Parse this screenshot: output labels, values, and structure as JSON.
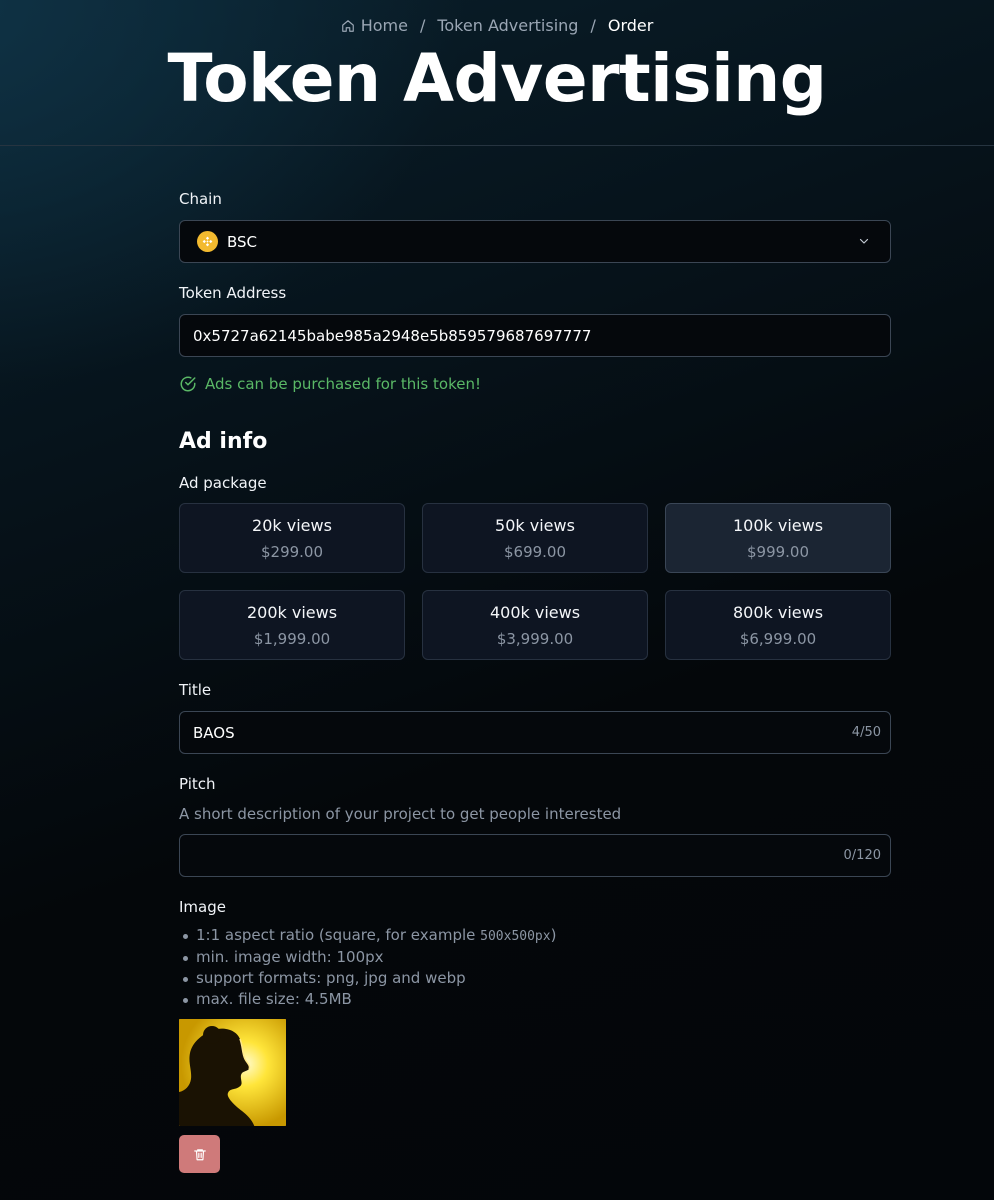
{
  "breadcrumb": {
    "home": "Home",
    "section": "Token Advertising",
    "current": "Order",
    "separator": "/"
  },
  "page": {
    "title": "Token Advertising"
  },
  "chain": {
    "label": "Chain",
    "selected": "BSC",
    "icon": "bnb-coin-icon"
  },
  "token_address": {
    "label": "Token Address",
    "value": "0x5727a62145babe985a2948e5b859579687697777",
    "status_icon": "check-circle-icon",
    "status": "Ads can be purchased for this token!"
  },
  "ad_info": {
    "title": "Ad info",
    "package_label": "Ad package",
    "packages": [
      {
        "views": "20k views",
        "price": "$299.00"
      },
      {
        "views": "50k views",
        "price": "$699.00"
      },
      {
        "views": "100k views",
        "price": "$999.00"
      },
      {
        "views": "200k views",
        "price": "$1,999.00"
      },
      {
        "views": "400k views",
        "price": "$3,999.00"
      },
      {
        "views": "800k views",
        "price": "$6,999.00"
      }
    ],
    "selected_package": "100k views"
  },
  "title_field": {
    "label": "Title",
    "value": "BAOS",
    "counter": "4/50"
  },
  "pitch_field": {
    "label": "Pitch",
    "help": "A short description of your project to get people interested",
    "value": "",
    "counter": "0/120"
  },
  "image": {
    "label": "Image",
    "requirements_prefix": "1:1 aspect ratio (square, for example ",
    "requirements_example": "500x500px",
    "requirements_suffix": ")",
    "requirements": [
      "min. image width: 100px",
      "support formats: png, jpg and webp",
      "max. file size: 4.5MB"
    ],
    "delete_icon": "trash-icon"
  },
  "colors": {
    "success": "#5ab866",
    "coin": "#f3ba2f",
    "delete_button": "#cf7a7a",
    "selected_package_bg": "#1b2533"
  }
}
